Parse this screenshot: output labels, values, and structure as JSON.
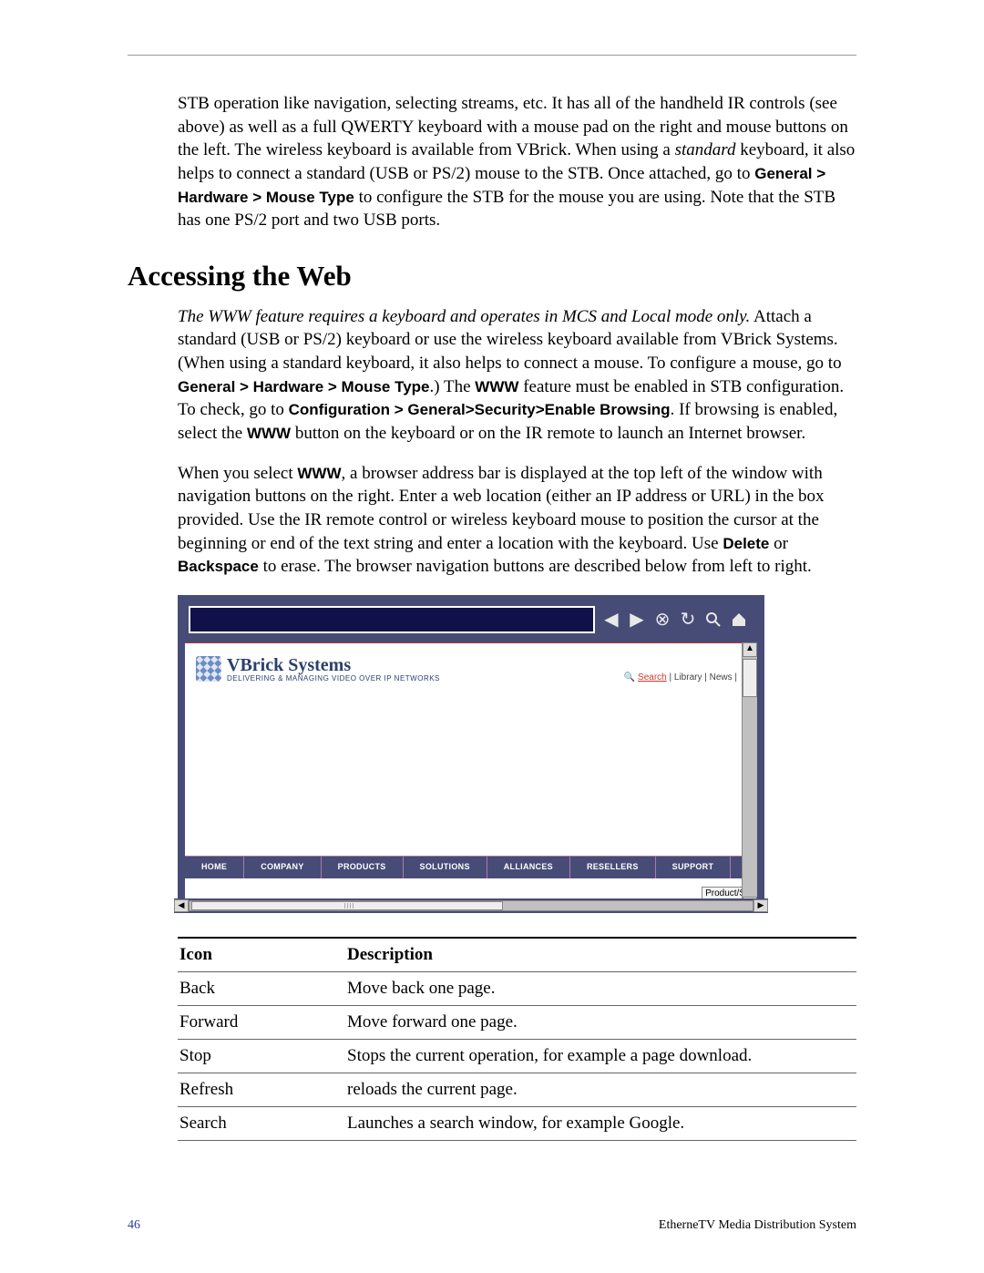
{
  "intro_paragraph": {
    "pre": "STB operation like navigation, selecting streams, etc. It has all of the handheld IR controls (see above) as well as a full QWERTY keyboard with a mouse pad on the right and mouse buttons on the left. The wireless keyboard is available from VBrick. When using a ",
    "italic1": "standard",
    "mid1": " keyboard, it also helps to connect a standard (USB or PS/2) mouse to the STB. Once attached, go to ",
    "sans1": "General > Hardware > Mouse Type",
    "post": " to configure the STB for the mouse you are using. Note that the STB has one PS/2 port and two USB ports."
  },
  "section_heading": "Accessing the Web",
  "para2": {
    "italic": "The WWW feature requires a keyboard and operates in MCS and Local mode only.",
    "t1": " Attach a standard (USB or PS/2) keyboard or use the wireless keyboard available from VBrick Systems. (When using a standard keyboard, it also helps to connect a mouse. To configure a mouse, go to ",
    "s1": "General > Hardware > Mouse Type",
    "t2": ".) The ",
    "s2": "WWW",
    "t3": " feature must be enabled in STB configuration. To check, go to ",
    "s3": "Configuration > General>Security>Enable Browsing",
    "t4": ". If browsing is enabled, select the ",
    "s4": "WWW",
    "t5": " button on the keyboard or on the IR remote to launch an Internet browser."
  },
  "para3": {
    "t1": "When you select ",
    "s1": "WWW",
    "t2": ", a browser address bar is displayed at the top left of the window with navigation buttons on the right. Enter a web location (either an IP address or URL) in the box provided. Use the IR remote control or wireless keyboard mouse to position the cursor at the beginning or end of the text string and enter a location with the keyboard. Use ",
    "s2": "Delete",
    "t3": " or ",
    "s3": "Backspace",
    "t4": " to erase. The browser navigation buttons are described below from left to right."
  },
  "browser": {
    "brand_title": "VBrick Systems",
    "brand_tag": "DELIVERING & MANAGING VIDEO OVER IP NETWORKS",
    "links_search": "Search",
    "links_rest": " | Library | News |",
    "nav": [
      "HOME",
      "COMPANY",
      "PRODUCTS",
      "SOLUTIONS",
      "ALLIANCES",
      "RESELLERS",
      "SUPPORT"
    ],
    "product_label": "Product/Sc"
  },
  "table": {
    "h_icon": "Icon",
    "h_desc": "Description",
    "rows": [
      {
        "icon": "Back",
        "desc": "Move back one page."
      },
      {
        "icon": "Forward",
        "desc": "Move forward one page."
      },
      {
        "icon": "Stop",
        "desc": "Stops the current operation, for example a page download."
      },
      {
        "icon": "Refresh",
        "desc": "reloads the current page."
      },
      {
        "icon": "Search",
        "desc": "Launches a search window, for example Google."
      }
    ]
  },
  "footer": {
    "page": "46",
    "title": "EtherneTV Media Distribution System"
  }
}
